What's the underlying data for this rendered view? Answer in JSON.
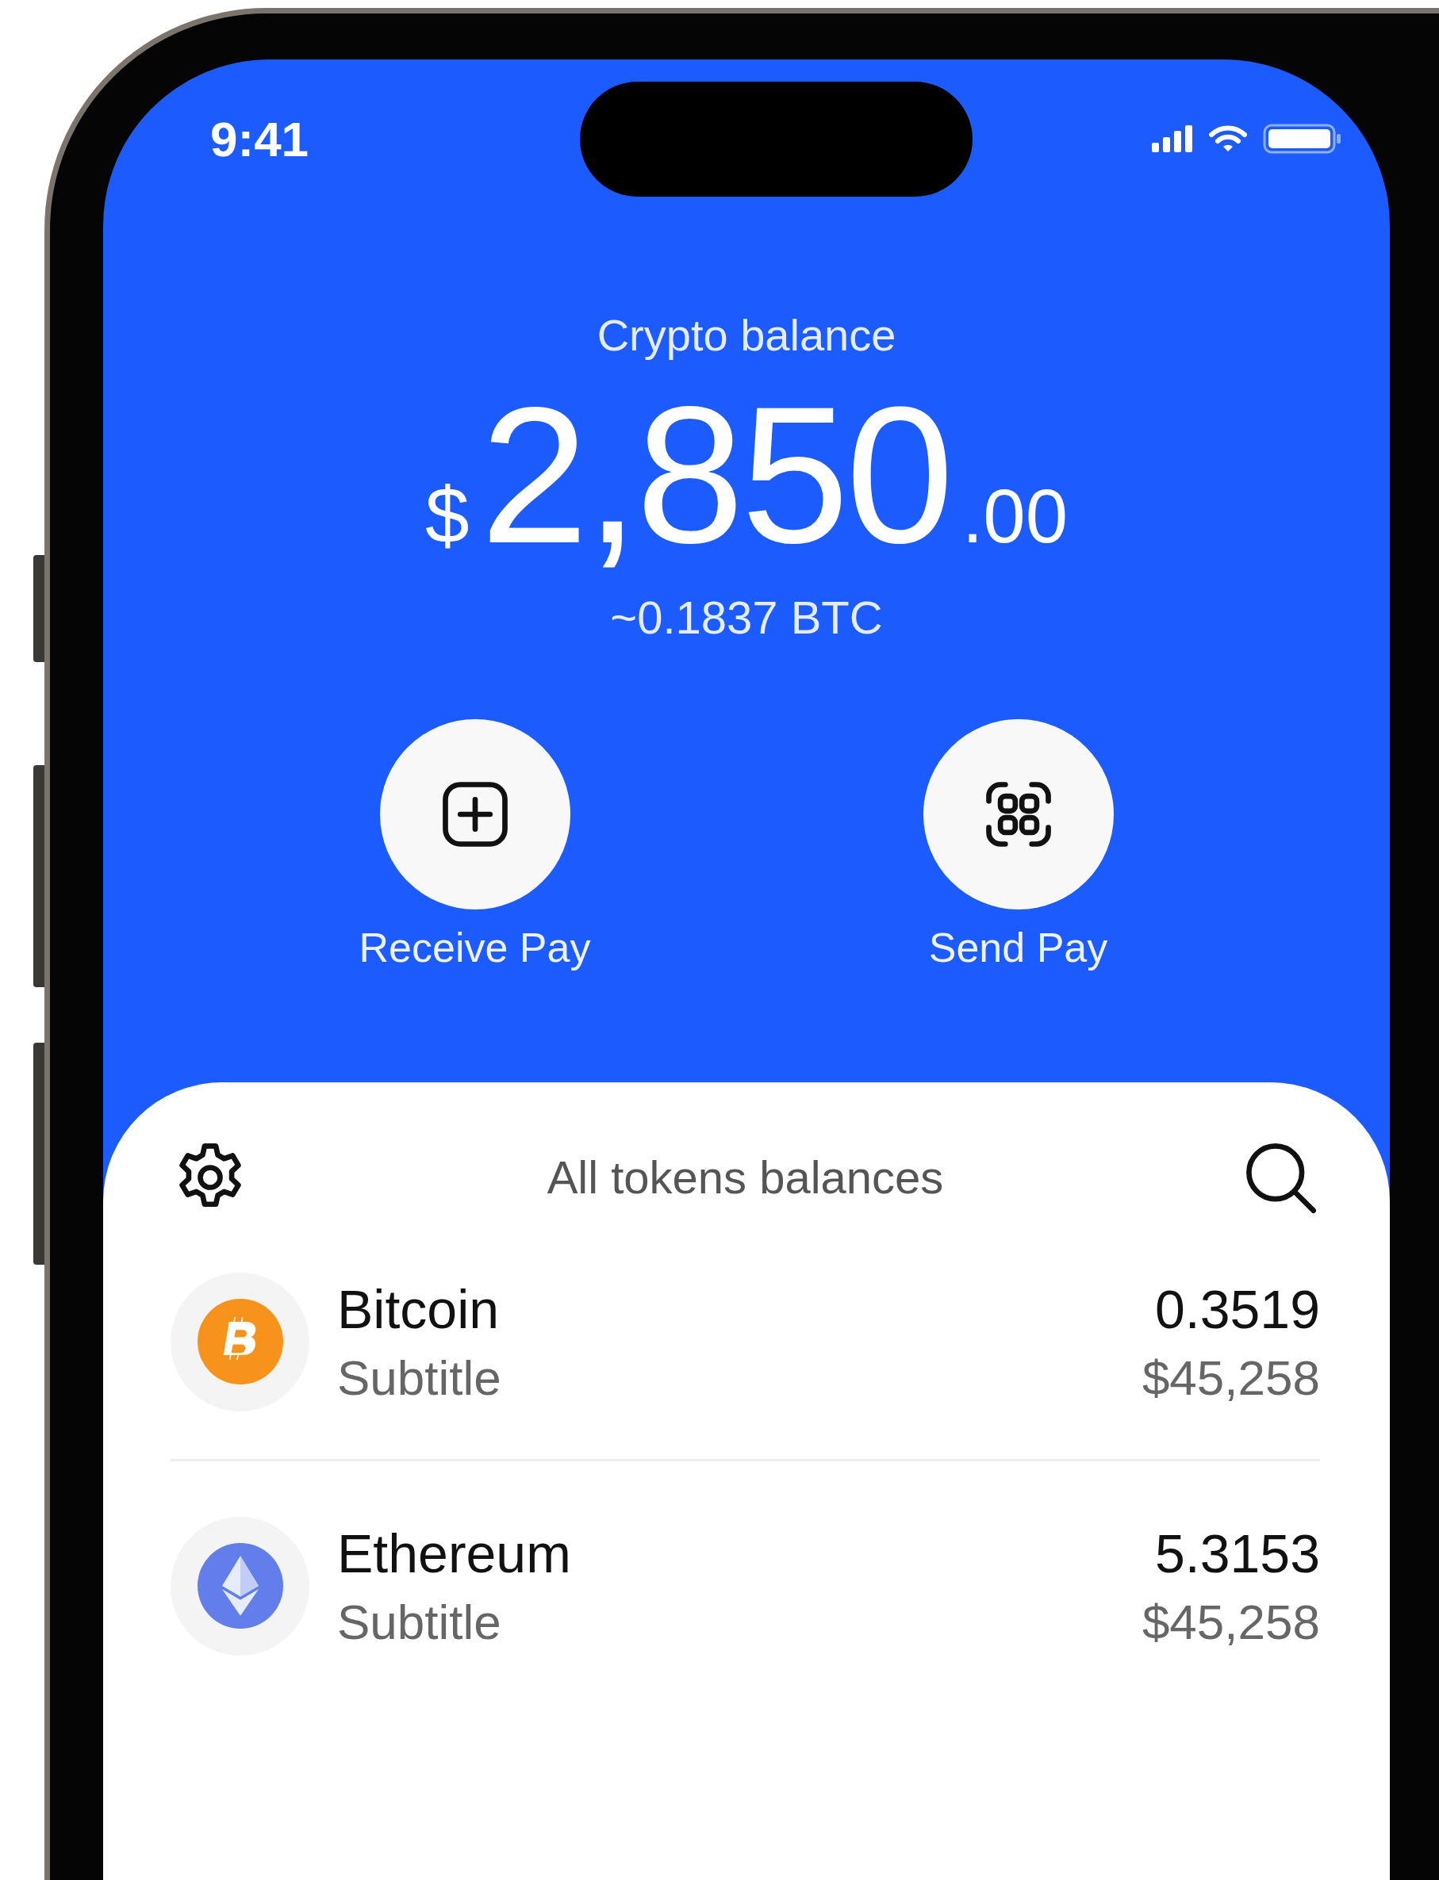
{
  "status_bar": {
    "time": "9:41"
  },
  "balance": {
    "label": "Crypto balance",
    "currency": "$",
    "whole": "2,850",
    "fraction": ".00",
    "approx": "~0.1837 BTC"
  },
  "actions": [
    {
      "kind": "receive",
      "label": "Receive Pay"
    },
    {
      "kind": "send",
      "label": "Send Pay"
    }
  ],
  "tokens_panel": {
    "title": "All tokens balances",
    "tokens": [
      {
        "kind": "bitcoin",
        "name": "Bitcoin",
        "subtitle": "Subtitle",
        "amount": "0.3519",
        "value": "$45,258"
      },
      {
        "kind": "ethereum",
        "name": "Ethereum",
        "subtitle": "Subtitle",
        "amount": "5.3153",
        "value": "$45,258"
      }
    ]
  }
}
